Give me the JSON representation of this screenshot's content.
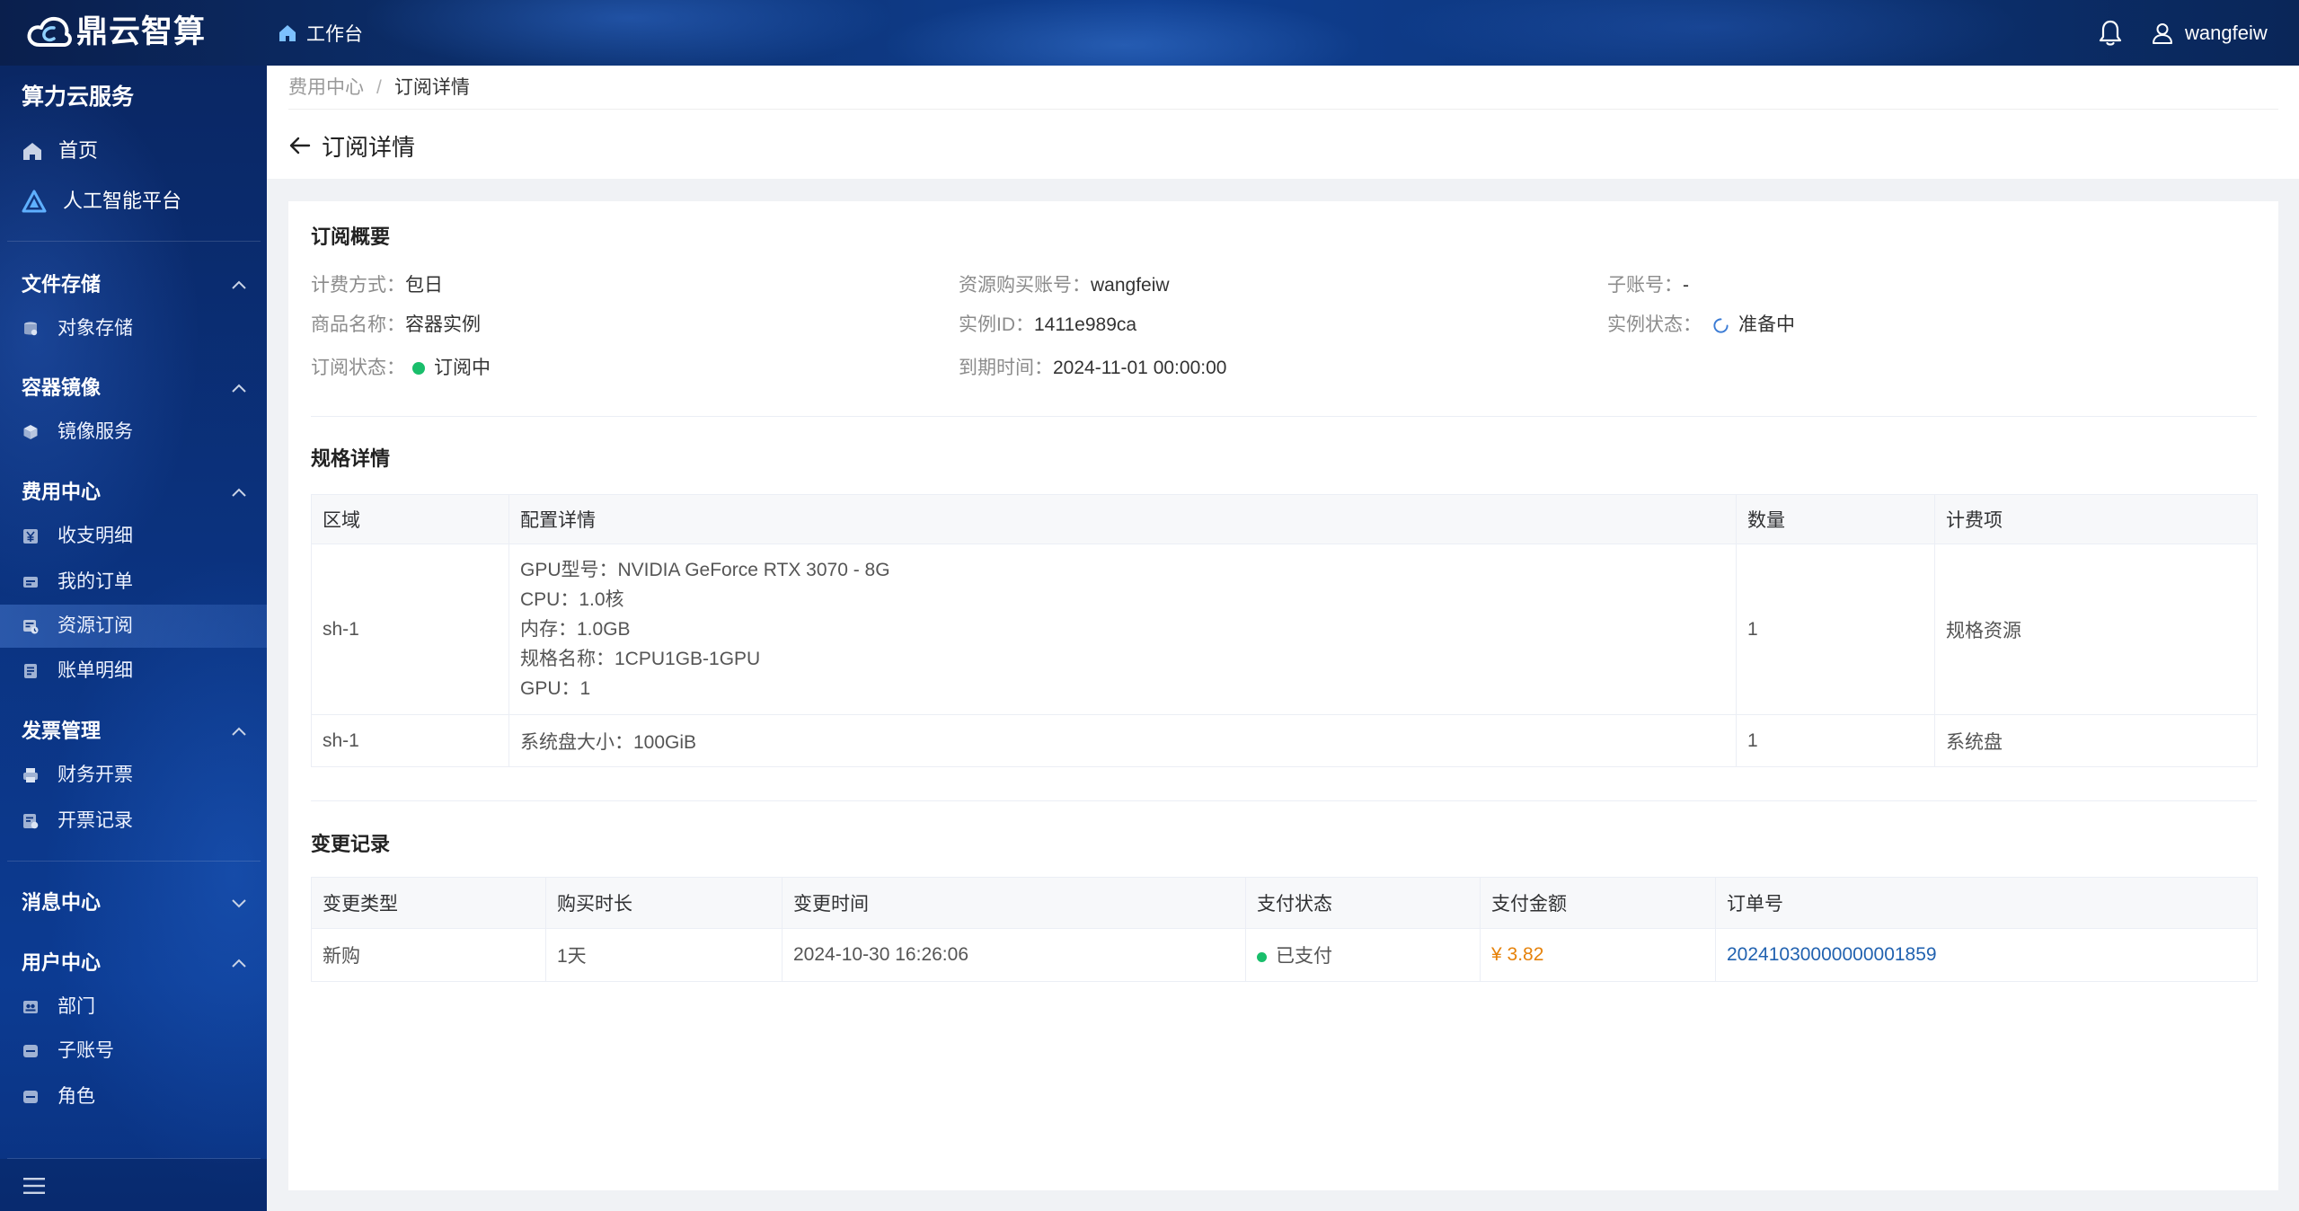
{
  "app": {
    "logo_text": "鼎云智算",
    "workbench_label": "工作台",
    "username": "wangfeiw",
    "logo_icon": "cloud-logo-icon",
    "workbench_icon": "home-icon",
    "notification_icon": "bell-icon",
    "user_icon": "user-icon"
  },
  "sidebar": {
    "title": "算力云服务",
    "top_items": [
      {
        "label": "首页",
        "icon": "home-icon"
      },
      {
        "label": "人工智能平台",
        "icon": "ai-platform-icon"
      }
    ],
    "groups": [
      {
        "title": "文件存储",
        "chevron": "chevron-up-icon",
        "items": [
          {
            "label": "对象存储",
            "icon": "object-storage-icon"
          }
        ]
      },
      {
        "title": "容器镜像",
        "chevron": "chevron-up-icon",
        "items": [
          {
            "label": "镜像服务",
            "icon": "cube-icon"
          }
        ]
      },
      {
        "title": "费用中心",
        "chevron": "chevron-up-icon",
        "items": [
          {
            "label": "收支明细",
            "icon": "yen-icon"
          },
          {
            "label": "我的订单",
            "icon": "order-icon"
          },
          {
            "label": "资源订阅",
            "icon": "subscription-icon",
            "active": true
          },
          {
            "label": "账单明细",
            "icon": "bill-icon"
          }
        ]
      },
      {
        "title": "发票管理",
        "chevron": "chevron-up-icon",
        "items": [
          {
            "label": "财务开票",
            "icon": "printer-icon"
          },
          {
            "label": "开票记录",
            "icon": "invoice-record-icon"
          }
        ]
      },
      {
        "title": "消息中心",
        "chevron": "chevron-down-icon",
        "items": []
      },
      {
        "title": "用户中心",
        "chevron": "chevron-up-icon",
        "items": [
          {
            "label": "部门",
            "icon": "department-icon"
          },
          {
            "label": "子账号",
            "icon": "sub-account-icon"
          },
          {
            "label": "角色",
            "icon": "role-icon"
          }
        ]
      }
    ],
    "collapse_icon": "hamburger-menu-icon"
  },
  "breadcrumb": {
    "parent": "费用中心",
    "separator": "/",
    "current": "订阅详情"
  },
  "page": {
    "title": "订阅详情",
    "back_icon": "arrow-left-icon"
  },
  "overview": {
    "title": "订阅概要",
    "fields": [
      {
        "label": "计费方式：",
        "value": "包日"
      },
      {
        "label": "资源购买账号：",
        "value": "wangfeiw"
      },
      {
        "label": "子账号：",
        "value": "-"
      },
      {
        "label": "商品名称：",
        "value": "容器实例"
      },
      {
        "label": "实例ID：",
        "value": "1411e989ca"
      },
      {
        "label": "实例状态：",
        "value": "准备中",
        "icon": "loading-spinner-icon"
      },
      {
        "label": "订阅状态：",
        "value": "订阅中",
        "icon": "status-dot-icon"
      },
      {
        "label": "到期时间：",
        "value": "2024-11-01 00:00:00"
      }
    ]
  },
  "spec": {
    "title": "规格详情",
    "columns": [
      "区域",
      "配置详情",
      "数量",
      "计费项"
    ],
    "rows": [
      {
        "region": "sh-1",
        "config": [
          "GPU型号：NVIDIA GeForce RTX 3070 - 8G",
          "CPU：1.0核",
          "内存：1.0GB",
          "规格名称：1CPU1GB-1GPU",
          "GPU：1"
        ],
        "quantity": "1",
        "billing_item": "规格资源"
      },
      {
        "region": "sh-1",
        "config": [
          "系统盘大小：100GiB"
        ],
        "quantity": "1",
        "billing_item": "系统盘"
      }
    ]
  },
  "changes": {
    "title": "变更记录",
    "columns": [
      "变更类型",
      "购买时长",
      "变更时间",
      "支付状态",
      "支付金额",
      "订单号"
    ],
    "rows": [
      {
        "type": "新购",
        "duration": "1天",
        "time": "2024-10-30 16:26:06",
        "pay_status": "已支付",
        "amount": "¥ 3.82",
        "order_no": "20241030000000001859"
      }
    ]
  },
  "colors": {
    "topbar": "#0c3170",
    "sidebar": "#0b3380",
    "link": "#2162b0",
    "amount": "#e6820a",
    "success": "#19be6b",
    "spinner": "#3a7bd5",
    "text": "#333333",
    "label": "#8c8c8c"
  }
}
